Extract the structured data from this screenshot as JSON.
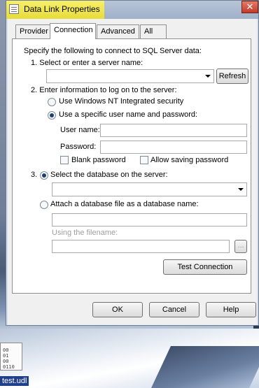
{
  "window": {
    "title": "Data Link Properties",
    "close_glyph": "✕"
  },
  "tabs": [
    {
      "label": "Provider",
      "active": false
    },
    {
      "label": "Connection",
      "active": true
    },
    {
      "label": "Advanced",
      "active": false
    },
    {
      "label": "All",
      "active": false
    }
  ],
  "connection": {
    "intro": "Specify the following to connect to SQL Server data:",
    "step1_label": "1. Select or enter a server name:",
    "server_name_value": "",
    "refresh_button": "Refresh",
    "step2_label": "2. Enter information to log on to the server:",
    "radio_windows_nt": "Use Windows NT Integrated security",
    "radio_specific_user": "Use a specific user name and password:",
    "selected_logon": "specific_user",
    "username_label": "User name:",
    "username_value": "",
    "password_label": "Password:",
    "password_value": "",
    "blank_password_label": "Blank password",
    "blank_password_checked": false,
    "allow_saving_label": "Allow saving password",
    "allow_saving_checked": false,
    "step3_number": "3.",
    "radio_select_db": "Select the database on the server:",
    "database_value": "",
    "radio_attach_db": "Attach a database file as a database name:",
    "attach_db_name_value": "",
    "filename_label": "Using the filename:",
    "filename_value": "",
    "browse_button": "...",
    "test_connection_button": "Test Connection"
  },
  "footer": {
    "ok": "OK",
    "cancel": "Cancel",
    "help": "Help"
  },
  "desktop": {
    "file_label": "test.udl",
    "file_icon_lines": [
      "00",
      "01",
      "00",
      "0110"
    ]
  },
  "colors": {
    "selection_blue": "#1f3f8b",
    "title_highlight": "#f2e84f"
  }
}
